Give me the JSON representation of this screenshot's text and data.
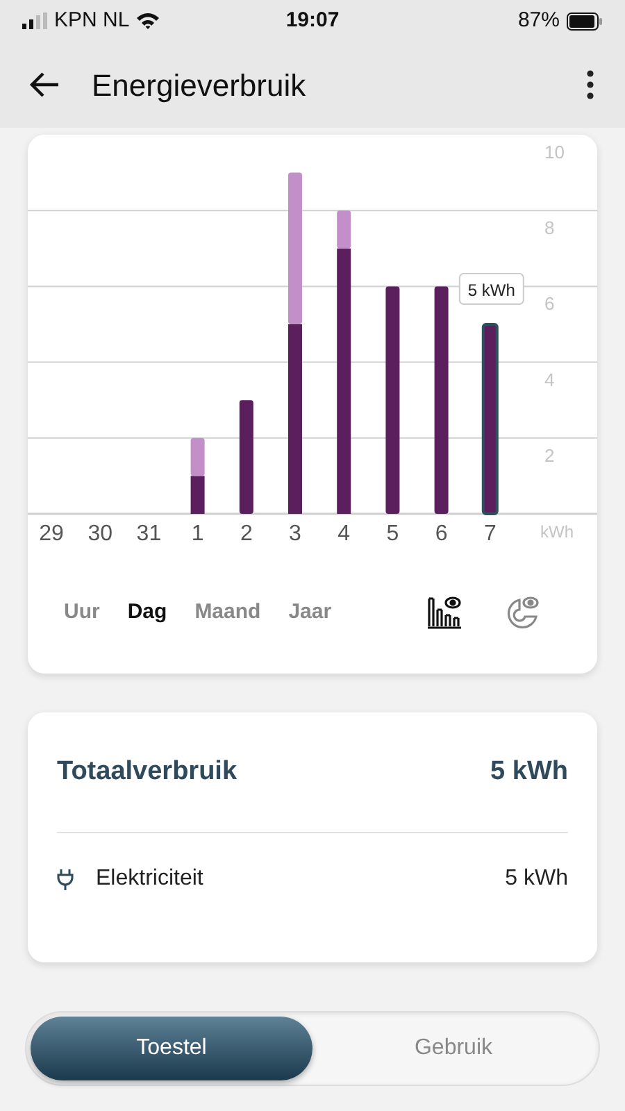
{
  "status_bar": {
    "carrier": "KPN NL",
    "time": "19:07",
    "battery": "87%"
  },
  "header": {
    "title": "Energieverbruik"
  },
  "chart": {
    "chart_data": {
      "type": "bar",
      "stacked": true,
      "categories": [
        "29",
        "30",
        "31",
        "1",
        "2",
        "3",
        "4",
        "5",
        "6",
        "7"
      ],
      "ylabel": "kWh",
      "yticks": [
        2,
        4,
        6,
        8,
        10
      ],
      "ylim": [
        0,
        10
      ],
      "series": [
        {
          "color": "#5c1f5e",
          "values": [
            0,
            0,
            0,
            1,
            3,
            5,
            7,
            6,
            6,
            5
          ]
        },
        {
          "color": "#c38fc9",
          "values": [
            0,
            0,
            0,
            1,
            0,
            4,
            1,
            0,
            0,
            0
          ]
        }
      ],
      "grid": true,
      "annotations": [
        "5 kWh"
      ]
    },
    "bars": [
      {
        "selected": false
      },
      {
        "selected": false
      },
      {
        "selected": false
      },
      {
        "selected": false
      },
      {
        "selected": false
      },
      {
        "selected": false
      },
      {
        "selected": false
      },
      {
        "selected": false
      },
      {
        "selected": false
      },
      {
        "selected": true
      }
    ]
  },
  "periods": [
    {
      "label": "Uur",
      "selected": false
    },
    {
      "label": "Dag",
      "selected": true
    },
    {
      "label": "Maand",
      "selected": false
    },
    {
      "label": "Jaar",
      "selected": false
    }
  ],
  "views": [
    {
      "kind": "bar",
      "selected": true
    },
    {
      "kind": "pie",
      "selected": false
    }
  ],
  "summary": {
    "label": "Totaalverbruik",
    "value": "5 kWh",
    "rows": [
      {
        "label": "Elektriciteit",
        "value": "5 kWh"
      }
    ]
  },
  "segments": [
    {
      "label": "Toestel",
      "selected": true
    },
    {
      "label": "Gebruik",
      "selected": false
    }
  ]
}
